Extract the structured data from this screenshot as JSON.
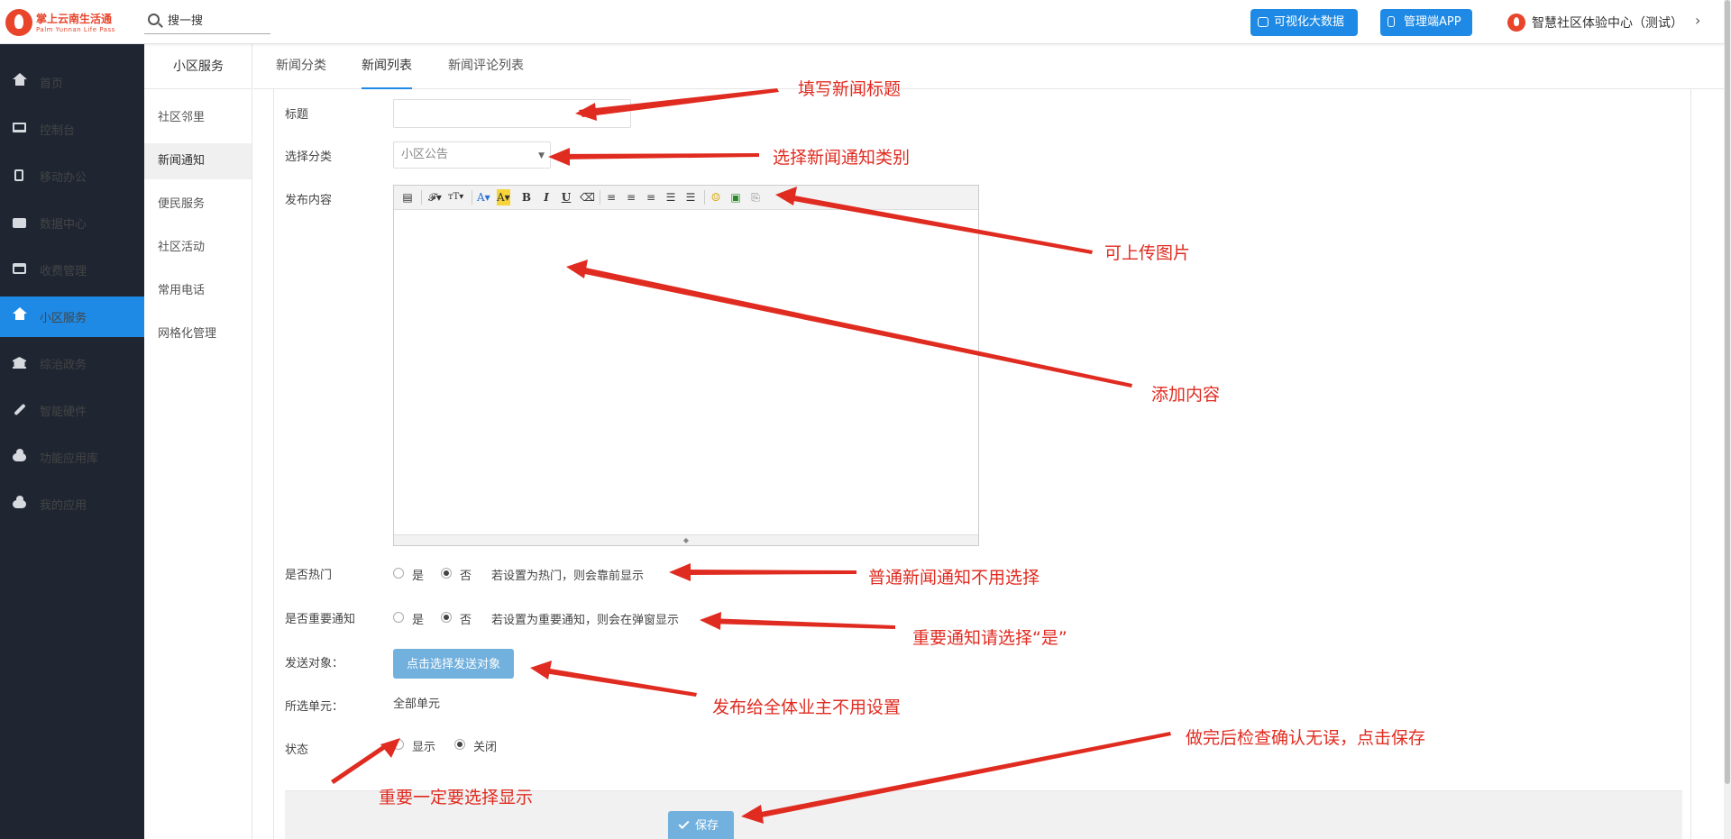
{
  "header": {
    "logo_title": "掌上云南生活通",
    "logo_subtitle": "Palm Yunnan Life Pass",
    "search_placeholder": "搜一搜",
    "btn_bigdata": "可视化大数据",
    "btn_app": "管理端APP",
    "user_name": "智慧社区体验中心（测试）"
  },
  "leftnav": {
    "items": [
      {
        "label": "首页",
        "icon": "home-icon"
      },
      {
        "label": "控制台",
        "icon": "laptop-icon"
      },
      {
        "label": "移动办公",
        "icon": "mobile-icon"
      },
      {
        "label": "数据中心",
        "icon": "briefcase-icon"
      },
      {
        "label": "收费管理",
        "icon": "credit-card-icon"
      },
      {
        "label": "小区服务",
        "icon": "home-icon",
        "active": true
      },
      {
        "label": "综治政务",
        "icon": "bank-icon"
      },
      {
        "label": "智能硬件",
        "icon": "wrench-icon"
      },
      {
        "label": "功能应用库",
        "icon": "cloud-download-icon"
      },
      {
        "label": "我的应用",
        "icon": "cloud-icon"
      }
    ]
  },
  "subnav": {
    "title": "小区服务",
    "items": [
      "社区邻里",
      "新闻通知",
      "便民服务",
      "社区活动",
      "常用电话",
      "网格化管理"
    ],
    "active": "新闻通知"
  },
  "tabs": [
    "新闻分类",
    "新闻列表",
    "新闻评论列表"
  ],
  "form": {
    "title_label": "标题",
    "title_value": "",
    "category_label": "选择分类",
    "category_value": "小区公告",
    "content_label": "发布内容",
    "hot_label": "是否热门",
    "hot_yes": "是",
    "hot_no": "否",
    "hot_hint": "若设置为热门，则会靠前显示",
    "important_label": "是否重要通知",
    "important_yes": "是",
    "important_no": "否",
    "important_hint": "若设置为重要通知，则会在弹窗显示",
    "target_label": "发送对象：",
    "target_button": "点击选择发送对象",
    "unit_label": "所选单元：",
    "unit_value": "全部单元",
    "status_label": "状态",
    "status_show": "显示",
    "status_close": "关闭",
    "save_button": "保存"
  },
  "annotations": {
    "title": "填写新闻标题",
    "category": "选择新闻通知类别",
    "image": "可上传图片",
    "content": "添加内容",
    "hot": "普通新闻通知不用选择",
    "important": "重要通知请选择“是”",
    "target": "发布给全体业主不用设置",
    "status": "重要一定要选择显示",
    "save": "做完后检查确认无误，点击保存"
  },
  "colors": {
    "primary": "#1e8ae5",
    "sidebar_bg": "#1f2632",
    "annotation": "#e02b20",
    "button_muted": "#72b1de"
  }
}
